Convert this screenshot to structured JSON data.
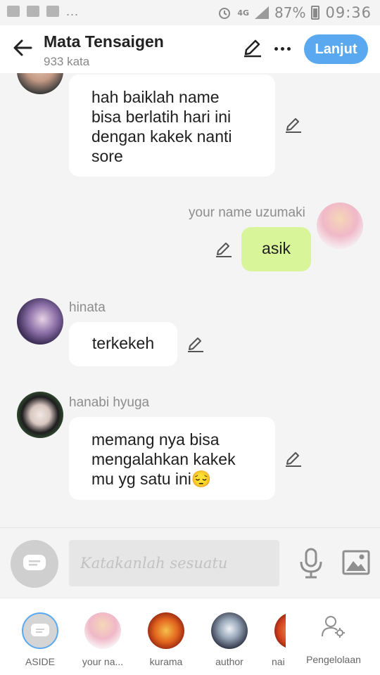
{
  "status_bar": {
    "battery": "87%",
    "time": "09:36",
    "network": "4G",
    "overflow": "..."
  },
  "header": {
    "title": "Mata Tensaigen",
    "word_count": "933 kata",
    "next_label": "Lanjut"
  },
  "colors": {
    "accent": "#5aa9f0",
    "my_bubble": "#d8f59a",
    "other_bubble": "#ffffff",
    "background": "#f4f4f4"
  },
  "messages": [
    {
      "sender": "",
      "text": "hah baiklah name bisa berlatih hari ini dengan kakek nanti sore",
      "side": "left",
      "avatar": "partial-avatar"
    },
    {
      "sender": "your name uzumaki",
      "text": "asik",
      "side": "right",
      "avatar": "anime-girl-pink-avatar"
    },
    {
      "sender": "hinata",
      "text": "terkekeh",
      "side": "left",
      "avatar": "hinata-avatar"
    },
    {
      "sender": "hanabi hyuga",
      "text": "memang nya bisa mengalahkan kakek mu yg satu ini😔",
      "side": "left",
      "avatar": "hanabi-avatar"
    }
  ],
  "composer": {
    "placeholder": "Katakanlah sesuatu"
  },
  "characters": [
    {
      "label": "ASIDE",
      "icon": "chat-bubble-icon"
    },
    {
      "label": "your na...",
      "icon": "anime-girl-pink-avatar"
    },
    {
      "label": "kurama",
      "icon": "fox-avatar"
    },
    {
      "label": "author",
      "icon": "author-avatar"
    },
    {
      "label": "nai",
      "icon": "partial-avatar"
    }
  ],
  "manage_label": "Pengelolaan"
}
